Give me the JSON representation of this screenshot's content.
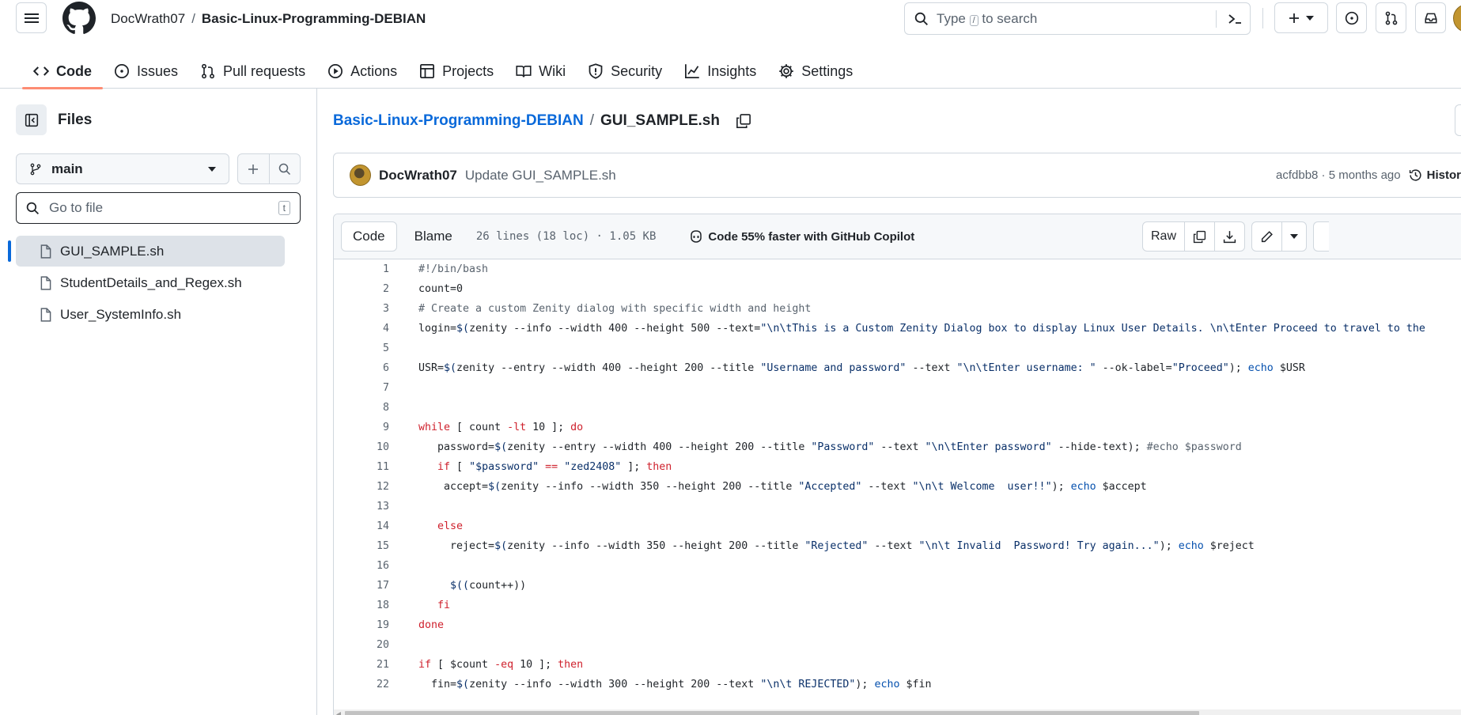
{
  "header": {
    "owner": "DocWrath07",
    "separator": "/",
    "repo": "Basic-Linux-Programming-DEBIAN",
    "search_placeholder_prefix": "Type",
    "search_key": "/",
    "search_placeholder_suffix": "to search"
  },
  "tabs": [
    {
      "label": "Code",
      "icon": "code-icon"
    },
    {
      "label": "Issues",
      "icon": "issue-icon"
    },
    {
      "label": "Pull requests",
      "icon": "pull-request-icon"
    },
    {
      "label": "Actions",
      "icon": "play-icon"
    },
    {
      "label": "Projects",
      "icon": "table-icon"
    },
    {
      "label": "Wiki",
      "icon": "book-icon"
    },
    {
      "label": "Security",
      "icon": "shield-icon"
    },
    {
      "label": "Insights",
      "icon": "graph-icon"
    },
    {
      "label": "Settings",
      "icon": "gear-icon"
    }
  ],
  "sidebar": {
    "title": "Files",
    "branch": "main",
    "goto_placeholder": "Go to file",
    "goto_key": "t",
    "files": [
      "GUI_SAMPLE.sh",
      "StudentDetails_and_Regex.sh",
      "User_SystemInfo.sh"
    ]
  },
  "main": {
    "path_repo": "Basic-Linux-Programming-DEBIAN",
    "path_sep": "/",
    "path_file": "GUI_SAMPLE.sh",
    "commit": {
      "author": "DocWrath07",
      "message": "Update GUI_SAMPLE.sh",
      "sha_time": "acfdbb8 · 5 months ago",
      "history": "History"
    },
    "file_header": {
      "code": "Code",
      "blame": "Blame",
      "meta": "26 lines (18 loc) · 1.05 KB",
      "copilot": "Code 55% faster with GitHub Copilot",
      "raw": "Raw"
    }
  },
  "colors": {
    "accent": "#0969da",
    "tab_underline": "#fd8c73",
    "keyword": "#cf222e",
    "string": "#0a3069"
  },
  "code_lines": [
    {
      "n": "1",
      "t": "#!/bin/bash"
    },
    {
      "n": "2",
      "t": "count=0"
    },
    {
      "n": "3",
      "t": "# Create a custom Zenity dialog with specific width and height"
    },
    {
      "n": "4",
      "t": "login=$(zenity --info --width 400 --height 500 --text=\"\\n\\tThis is a Custom Zenity Dialog box to display Linux User Details. \\n\\tEnter Proceed to travel to the"
    },
    {
      "n": "5",
      "t": ""
    },
    {
      "n": "6",
      "t": "USR=$(zenity --entry --width 400 --height 200 --title \"Username and password\" --text \"\\n\\tEnter username: \" --ok-label=\"Proceed\"); echo $USR"
    },
    {
      "n": "7",
      "t": ""
    },
    {
      "n": "8",
      "t": ""
    },
    {
      "n": "9",
      "t": "while [ count -lt 10 ]; do"
    },
    {
      "n": "10",
      "t": "   password=$(zenity --entry --width 400 --height 200 --title \"Password\" --text \"\\n\\tEnter password\" --hide-text); #echo $password"
    },
    {
      "n": "11",
      "t": "   if [ \"$password\" == \"zed2408\" ]; then"
    },
    {
      "n": "12",
      "t": "    accept=$(zenity --info --width 350 --height 200 --title \"Accepted\" --text \"\\n\\t Welcome  user!!\"); echo $accept"
    },
    {
      "n": "13",
      "t": ""
    },
    {
      "n": "14",
      "t": "   else"
    },
    {
      "n": "15",
      "t": "     reject=$(zenity --info --width 350 --height 200 --title \"Rejected\" --text \"\\n\\t Invalid  Password! Try again...\"); echo $reject"
    },
    {
      "n": "16",
      "t": ""
    },
    {
      "n": "17",
      "t": "     $((count++))"
    },
    {
      "n": "18",
      "t": "   fi"
    },
    {
      "n": "19",
      "t": "done"
    },
    {
      "n": "20",
      "t": ""
    },
    {
      "n": "21",
      "t": "if [ $count -eq 10 ]; then"
    },
    {
      "n": "22",
      "t": "  fin=$(zenity --info --width 300 --height 200 --text \"\\n\\t REJECTED\"); echo $fin"
    }
  ]
}
